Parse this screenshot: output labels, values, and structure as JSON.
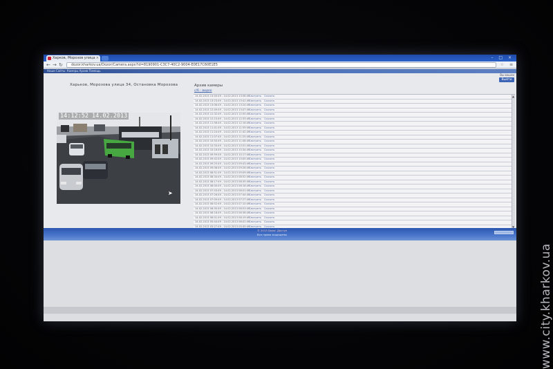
{
  "browser": {
    "tab_title": "Харков, Морозов улица",
    "url": "dozor.kharkov.ua/Dozor/Camera.aspx?id=8190901-C3C7-40C2-9004-E0E17C60E1E5",
    "site_nav": "Наши Сайты:  Камеры  Архив  Помощь"
  },
  "page": {
    "login_text": "Вы вошли",
    "exit_label": "Выйти",
    "camera_title": "Харьков, Морозова улица 34, Остановка Морозова",
    "camera_timestamp": "14:12:52 14.02.2013",
    "archive_title": "Архив камеры",
    "archive_link": "с/6 - видео",
    "archive_rows": [
      {
        "range": "14.02.2013 13:40:49 - 14.02.2013 13:58:49",
        "view": "Смотреть",
        "download": "Скачать"
      },
      {
        "range": "14.02.2013 13:23:49 - 14.02.2013 13:41:49",
        "view": "Смотреть",
        "download": "Скачать"
      },
      {
        "range": "14.02.2013 13:06:49 - 14.02.2013 13:24:49",
        "view": "Смотреть",
        "download": "Скачать"
      },
      {
        "range": "14.02.2013 12:49:49 - 14.02.2013 13:07:49",
        "view": "Смотреть",
        "download": "Скачать"
      },
      {
        "range": "14.02.2013 12:32:49 - 14.02.2013 12:50:49",
        "view": "Смотреть",
        "download": "Скачать"
      },
      {
        "range": "14.02.2013 12:15:49 - 14.02.2013 12:33:49",
        "view": "Смотреть",
        "download": "Скачать"
      },
      {
        "range": "14.02.2013 11:58:49 - 14.02.2013 12:16:49",
        "view": "Смотреть",
        "download": "Скачать"
      },
      {
        "range": "14.02.2013 11:41:49 - 14.02.2013 11:59:49",
        "view": "Смотреть",
        "download": "Скачать"
      },
      {
        "range": "14.02.2013 11:24:49 - 14.02.2013 11:42:49",
        "view": "Смотреть",
        "download": "Скачать"
      },
      {
        "range": "14.02.2013 11:07:49 - 14.02.2013 11:25:49",
        "view": "Смотреть",
        "download": "Скачать"
      },
      {
        "range": "14.02.2013 10:50:49 - 14.02.2013 11:08:49",
        "view": "Смотреть",
        "download": "Скачать"
      },
      {
        "range": "14.02.2013 10:33:49 - 14.02.2013 10:51:49",
        "view": "Смотреть",
        "download": "Скачать"
      },
      {
        "range": "14.02.2013 10:16:49 - 14.02.2013 10:34:49",
        "view": "Смотреть",
        "download": "Скачать"
      },
      {
        "range": "14.02.2013 09:59:49 - 14.02.2013 10:17:49",
        "view": "Смотреть",
        "download": "Скачать"
      },
      {
        "range": "14.02.2013 09:42:49 - 14.02.2013 10:00:49",
        "view": "Смотреть",
        "download": "Скачать"
      },
      {
        "range": "14.02.2013 09:25:49 - 14.02.2013 09:43:49",
        "view": "Смотреть",
        "download": "Скачать"
      },
      {
        "range": "14.02.2013 09:08:49 - 14.02.2013 09:26:49",
        "view": "Смотреть",
        "download": "Скачать"
      },
      {
        "range": "14.02.2013 08:51:49 - 14.02.2013 09:09:49",
        "view": "Смотреть",
        "download": "Скачать"
      },
      {
        "range": "14.02.2013 08:34:49 - 14.02.2013 08:52:49",
        "view": "Смотреть",
        "download": "Скачать"
      },
      {
        "range": "14.02.2013 08:17:49 - 14.02.2013 08:35:49",
        "view": "Смотреть",
        "download": "Скачать"
      },
      {
        "range": "14.02.2013 08:00:49 - 14.02.2013 08:18:49",
        "view": "Смотреть",
        "download": "Скачать"
      },
      {
        "range": "14.02.2013 07:43:49 - 14.02.2013 08:01:49",
        "view": "Смотреть",
        "download": "Скачать"
      },
      {
        "range": "14.02.2013 07:26:49 - 14.02.2013 07:44:49",
        "view": "Смотреть",
        "download": "Скачать"
      },
      {
        "range": "14.02.2013 07:09:49 - 14.02.2013 07:27:49",
        "view": "Смотреть",
        "download": "Скачать"
      },
      {
        "range": "14.02.2013 06:52:49 - 14.02.2013 07:10:49",
        "view": "Смотреть",
        "download": "Скачать"
      },
      {
        "range": "14.02.2013 06:35:49 - 14.02.2013 06:53:49",
        "view": "Смотреть",
        "download": "Скачать"
      },
      {
        "range": "14.02.2013 06:18:49 - 14.02.2013 06:36:49",
        "view": "Смотреть",
        "download": "Скачать"
      },
      {
        "range": "14.02.2013 06:01:49 - 14.02.2013 06:19:49",
        "view": "Смотреть",
        "download": "Скачать"
      },
      {
        "range": "14.02.2013 05:44:49 - 14.02.2013 06:02:49",
        "view": "Смотреть",
        "download": "Скачать"
      },
      {
        "range": "14.02.2013 05:27:49 - 14.02.2013 05:45:49",
        "view": "Смотреть",
        "download": "Скачать"
      }
    ],
    "status_left": "© 2013 Dozor. Доступ",
    "status_right": "Все права защищены"
  },
  "watermark": "www.city.kharkov.ua",
  "colors": {
    "chrome_blue": "#2a62c9",
    "status_blue": "#4b78cc",
    "page_bg": "#e8e9ec",
    "link_blue": "#3a5dab"
  },
  "icons": [
    "back-arrow-icon",
    "forward-arrow-icon",
    "reload-icon",
    "star-icon",
    "wrench-icon",
    "close-icon",
    "cursor-icon"
  ]
}
